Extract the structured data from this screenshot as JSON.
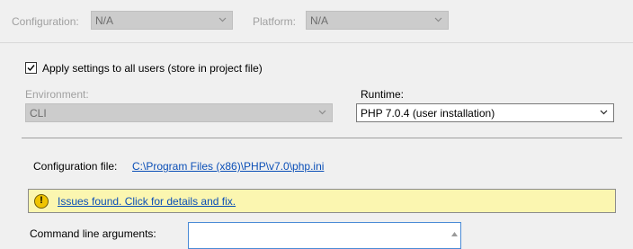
{
  "top": {
    "configuration_label": "Configuration:",
    "configuration_value": "N/A",
    "platform_label": "Platform:",
    "platform_value": "N/A"
  },
  "apply_settings": {
    "checked": true,
    "label": "Apply settings to all users (store in project file)"
  },
  "environment": {
    "label": "Environment:",
    "value": "CLI"
  },
  "runtime": {
    "label": "Runtime:",
    "value": "PHP 7.0.4 (user installation)"
  },
  "configuration_file": {
    "label": "Configuration file:",
    "path": "C:\\Program Files (x86)\\PHP\\v7.0\\php.ini"
  },
  "issues": {
    "icon": "exclamation-icon",
    "text": "Issues found. Click for details and fix.",
    "background": "#fbf6b0"
  },
  "command_line": {
    "label": "Command line arguments:",
    "value": ""
  }
}
